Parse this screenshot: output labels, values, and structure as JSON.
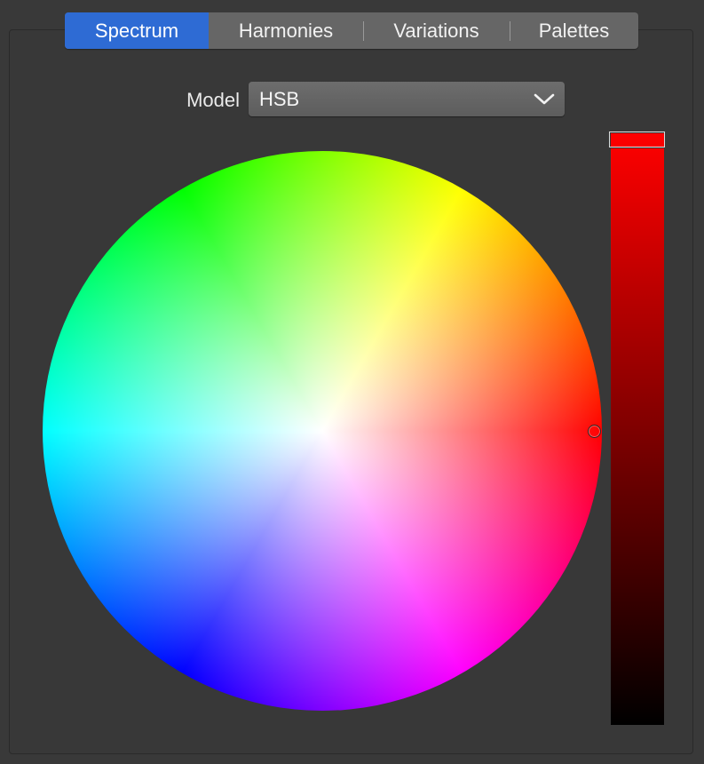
{
  "tabs": [
    {
      "label": "Spectrum",
      "active": true
    },
    {
      "label": "Harmonies",
      "active": false
    },
    {
      "label": "Variations",
      "active": false
    },
    {
      "label": "Palettes",
      "active": false
    }
  ],
  "model": {
    "label": "Model",
    "value": "HSB",
    "dropdown_icon": "chevron-down-icon"
  },
  "color_wheel": {
    "selected_hue_degrees": 0,
    "selected_saturation_percent": 100
  },
  "brightness_slider": {
    "value_percent": 100,
    "top_color": "#ff0000",
    "bottom_color": "#000000"
  },
  "colors": {
    "accent": "#2e6bd4",
    "background": "#393939",
    "tab_bar": "#666666"
  }
}
